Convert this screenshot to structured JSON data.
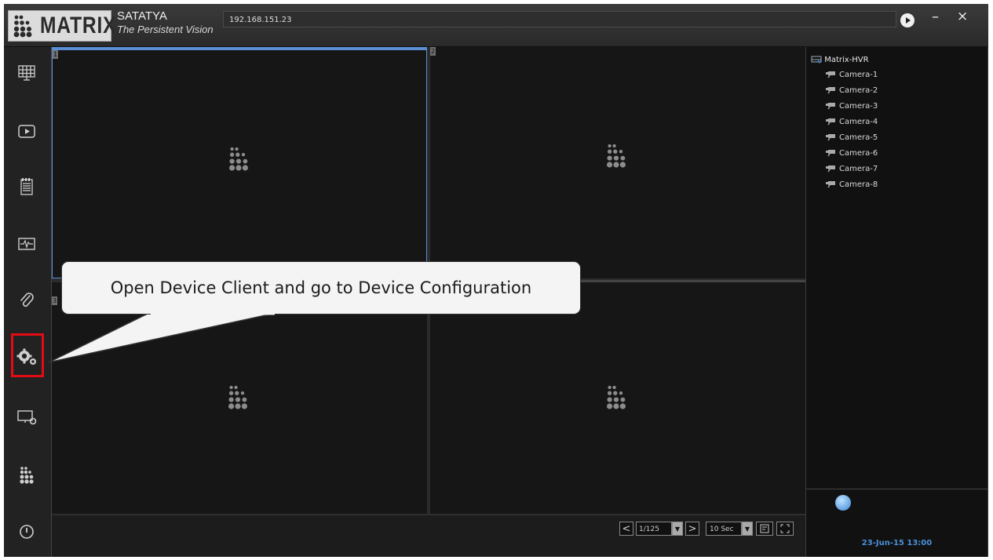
{
  "header": {
    "brand": "MATRIX",
    "product_name": "SATATYA",
    "product_tagline": "The Persistent Vision",
    "address": "192.168.151.23",
    "minimize_glyph": "–",
    "close_glyph": "×"
  },
  "sidebar": {
    "items": [
      {
        "name": "live-view",
        "icon": "video-wall-icon"
      },
      {
        "name": "playback",
        "icon": "play-icon"
      },
      {
        "name": "event-log",
        "icon": "notepad-icon"
      },
      {
        "name": "system-status",
        "icon": "monitor-graph-icon"
      },
      {
        "name": "attachments",
        "icon": "paperclip-icon"
      },
      {
        "name": "device-configuration",
        "icon": "gears-icon",
        "highlighted": true
      },
      {
        "name": "display-settings",
        "icon": "monitor-gear-icon"
      },
      {
        "name": "matrix-menu",
        "icon": "matrix-dots-icon"
      },
      {
        "name": "power",
        "icon": "power-icon"
      }
    ],
    "highlight_color": "#e30b14"
  },
  "grid": {
    "cells": [
      {
        "number": "1",
        "selected": true
      },
      {
        "number": "2"
      },
      {
        "number": "3"
      },
      {
        "number": "4"
      }
    ],
    "selection_color": "#5a8fd6"
  },
  "controls": {
    "prev_glyph": "<",
    "next_glyph": ">",
    "page": "1/125",
    "interval": "10 Sec",
    "drop_glyph": "▼"
  },
  "device_tree": {
    "root": "Matrix-HVR",
    "cameras": [
      "Camera-1",
      "Camera-2",
      "Camera-3",
      "Camera-4",
      "Camera-5",
      "Camera-6",
      "Camera-7",
      "Camera-8"
    ]
  },
  "status": {
    "datetime": "23-Jun-15 13:00",
    "accent_color": "#4a8fd8"
  },
  "callout": {
    "text": "Open Device Client and go to Device Configuration"
  }
}
